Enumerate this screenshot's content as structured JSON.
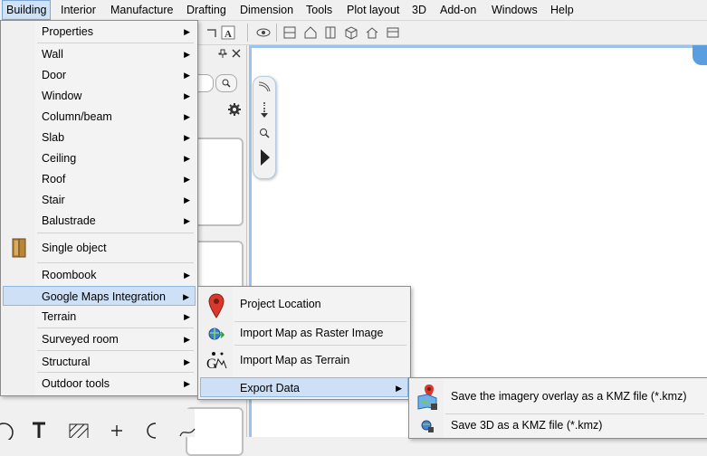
{
  "menubar": {
    "items": [
      "Building",
      "Interior",
      "Manufacture",
      "Drafting",
      "Dimension",
      "Tools",
      "Plot layout",
      "3D",
      "Add-on",
      "Windows",
      "Help"
    ]
  },
  "building_menu": {
    "items": [
      "Properties",
      "Wall",
      "Door",
      "Window",
      "Column/beam",
      "Slab",
      "Ceiling",
      "Roof",
      "Stair",
      "Balustrade",
      "Single object",
      "Roombook",
      "Google Maps Integration",
      "Terrain",
      "Surveyed room",
      "Structural",
      "Outdoor tools"
    ]
  },
  "google_maps_menu": {
    "items": [
      "Project Location",
      "Import Map as Raster Image",
      "Import Map as Terrain",
      "Export Data"
    ]
  },
  "export_menu": {
    "items": [
      "Save the imagery overlay as a KMZ file (*.kmz)",
      "Save 3D as a KMZ file (*.kmz)"
    ]
  },
  "colors": {
    "highlight": "#cde0f6",
    "pin_red": "#d9382c",
    "canvas_border": "#9dc3ea"
  }
}
